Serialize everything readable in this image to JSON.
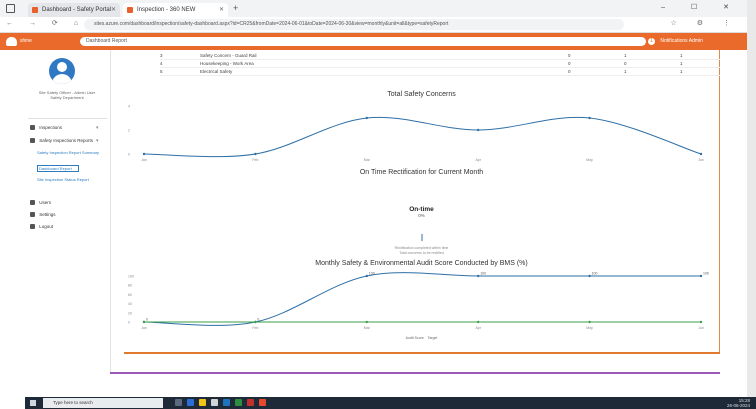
{
  "browser": {
    "tabs": [
      {
        "label": "Dashboard - Safety Portal"
      },
      {
        "label": "Inspection - 360 NEW"
      }
    ],
    "new_tab": "+",
    "window_controls": "– ☐ ✕",
    "nav": "← → ⟳ ⌂",
    "url": "sites.azure.com/dashboard/inspection/safety-dashboard.aspx?id=CR25&fromDate=2024-06-01&toDate=2024-06-30&view=monthly&unit=all&type=safetyReport",
    "right_icons": "☆ ⚙ ⋮"
  },
  "app_header": {
    "logo_text": "shine",
    "search_value": "Dashboard Report",
    "right_text": "Notifications  Admin",
    "bell": "1"
  },
  "sidebar": {
    "user_name": "Site Safety Officer - Admin User",
    "user_role": "Safety Department",
    "items": [
      {
        "label": "Inspections",
        "icon": "inspection-icon",
        "caret": "▾"
      },
      {
        "label": "Safety Inspections Reports",
        "icon": "report-icon",
        "caret": "▾"
      }
    ],
    "sub_items": [
      {
        "label": "Safety Inspection Report Summary"
      },
      {
        "label": "Dashboard Report"
      },
      {
        "label": "Site Inspection Status Report"
      }
    ],
    "bottom_items": [
      {
        "label": "Users",
        "icon": "users-icon"
      },
      {
        "label": "Settings",
        "icon": "settings-icon"
      },
      {
        "label": "Logout",
        "icon": "logout-icon"
      }
    ]
  },
  "table": {
    "rows": [
      {
        "no": "3",
        "name": "Safety Concern - Guard Rail",
        "c1": "0",
        "c2": "1",
        "c3": "1"
      },
      {
        "no": "4",
        "name": "Housekeeping - Work Area",
        "c1": "0",
        "c2": "0",
        "c3": "1"
      },
      {
        "no": "5",
        "name": "Electrical Safety",
        "c1": "0",
        "c2": "1",
        "c3": "1"
      }
    ]
  },
  "chart_data": [
    {
      "type": "line",
      "title": "Total Safety Concerns",
      "categories": [
        "Jan",
        "Feb",
        "Mar",
        "Apr",
        "May",
        "Jun"
      ],
      "series": [
        {
          "values": [
            0,
            0,
            3,
            2,
            3,
            0
          ]
        }
      ],
      "ylim": [
        0,
        4
      ],
      "yticks": [
        0,
        2,
        4
      ],
      "grid": false
    },
    {
      "type": "gauge",
      "title": "On Time Rectification for Current Month",
      "center_label": "On-time",
      "value_label": "0%",
      "value": 0,
      "notes": [
        "Rectification completed within time",
        "Total concerns to be rectified"
      ]
    },
    {
      "type": "line",
      "title": "Monthly Safety & Environmental Audit Score Conducted by BMS (%)",
      "categories": [
        "Jan",
        "Feb",
        "Mar",
        "Apr",
        "May",
        "Jun"
      ],
      "series": [
        {
          "values": [
            0,
            0,
            100,
            100,
            100,
            100
          ]
        },
        {
          "values": [
            0,
            0,
            0,
            0,
            0,
            0
          ]
        }
      ],
      "ylim": [
        0,
        100
      ],
      "yticks": [
        0,
        20,
        40,
        60,
        80,
        100
      ],
      "data_labels": [
        "0",
        "0",
        "100",
        "100",
        "100",
        "100"
      ],
      "legend": [
        "Audit Score",
        "Target"
      ],
      "legend_position": "bottom"
    }
  ],
  "colors": {
    "accent": "#ea6a2b",
    "line_blue": "#2d6fa6",
    "line_green": "#3aa14a",
    "divider_purple": "#9b58b8"
  },
  "taskbar": {
    "search_placeholder": "Type here to search",
    "time": "15:28",
    "date": "26-06-2024"
  }
}
